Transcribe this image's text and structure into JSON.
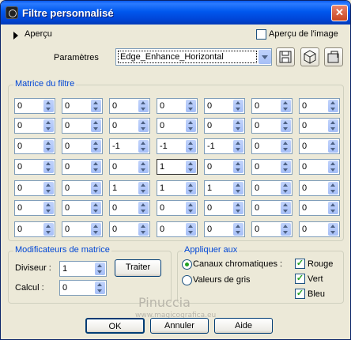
{
  "window": {
    "title": "Filtre personnalisé",
    "close_glyph": "✕"
  },
  "preview": {
    "toggle_label": "Aperçu",
    "image_preview_label": "Aperçu de l'image",
    "image_preview_checked": false
  },
  "params": {
    "label": "Paramètres",
    "selected": "Edge_Enhance_Horizontal"
  },
  "matrix": {
    "title": "Matrice du filtre",
    "rows": [
      [
        "0",
        "0",
        "0",
        "0",
        "0",
        "0",
        "0"
      ],
      [
        "0",
        "0",
        "0",
        "0",
        "0",
        "0",
        "0"
      ],
      [
        "0",
        "0",
        "-1",
        "-1",
        "-1",
        "0",
        "0"
      ],
      [
        "0",
        "0",
        "0",
        "1",
        "0",
        "0",
        "0"
      ],
      [
        "0",
        "0",
        "1",
        "1",
        "1",
        "0",
        "0"
      ],
      [
        "0",
        "0",
        "0",
        "0",
        "0",
        "0",
        "0"
      ],
      [
        "0",
        "0",
        "0",
        "0",
        "0",
        "0",
        "0"
      ]
    ]
  },
  "modifiers": {
    "title": "Modificateurs de matrice",
    "divisor_label": "Diviseur :",
    "divisor_value": "1",
    "bias_label": "Calcul :",
    "bias_value": "0",
    "apply_button": "Traiter"
  },
  "apply_to": {
    "title": "Appliquer aux",
    "color_channels": "Canaux chromatiques :",
    "grayscale": "Valeurs de gris",
    "red": "Rouge",
    "green": "Vert",
    "blue": "Bleu"
  },
  "buttons": {
    "ok": "OK",
    "cancel": "Annuler",
    "help": "Aide"
  },
  "watermark": {
    "name": "Pinuccia",
    "site": "www.magicografica.eu"
  }
}
